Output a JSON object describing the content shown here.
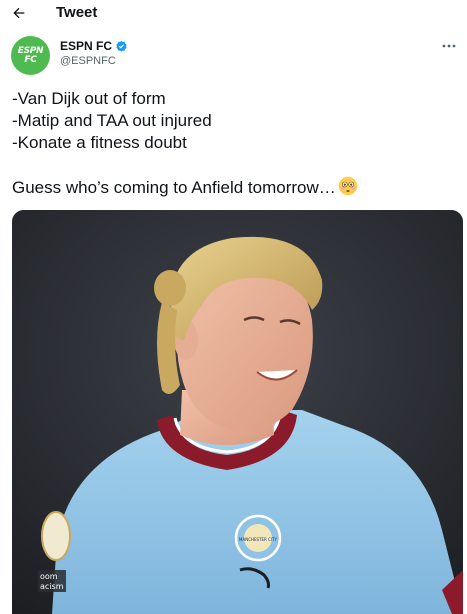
{
  "header": {
    "back_icon": "arrow-left-icon",
    "title": "Tweet"
  },
  "author": {
    "avatar_logo_line1": "ESPN",
    "avatar_logo_line2": "FC",
    "display_name": "ESPN FC",
    "verified_icon": "verified-badge-icon",
    "handle": "@ESPNFC",
    "more_icon": "more-horizontal-icon"
  },
  "tweet": {
    "lines": [
      "-Van Dijk out of form",
      "-Matip and TAA out injured",
      "-Konate a fitness doubt"
    ],
    "closing_line": "Guess who’s coming to Anfield tomorrow…",
    "emoji": "flushed-face-emoji"
  },
  "media": {
    "type": "photo",
    "badge_text": "MANCHESTER CITY",
    "sleeve_text": "oom\nacism"
  },
  "colors": {
    "avatar_bg": "#4fba4f",
    "verified": "#1d9bf0",
    "handle": "#536471",
    "kit_blue": "#8fc3e6",
    "collar": "#8b1b2b"
  }
}
